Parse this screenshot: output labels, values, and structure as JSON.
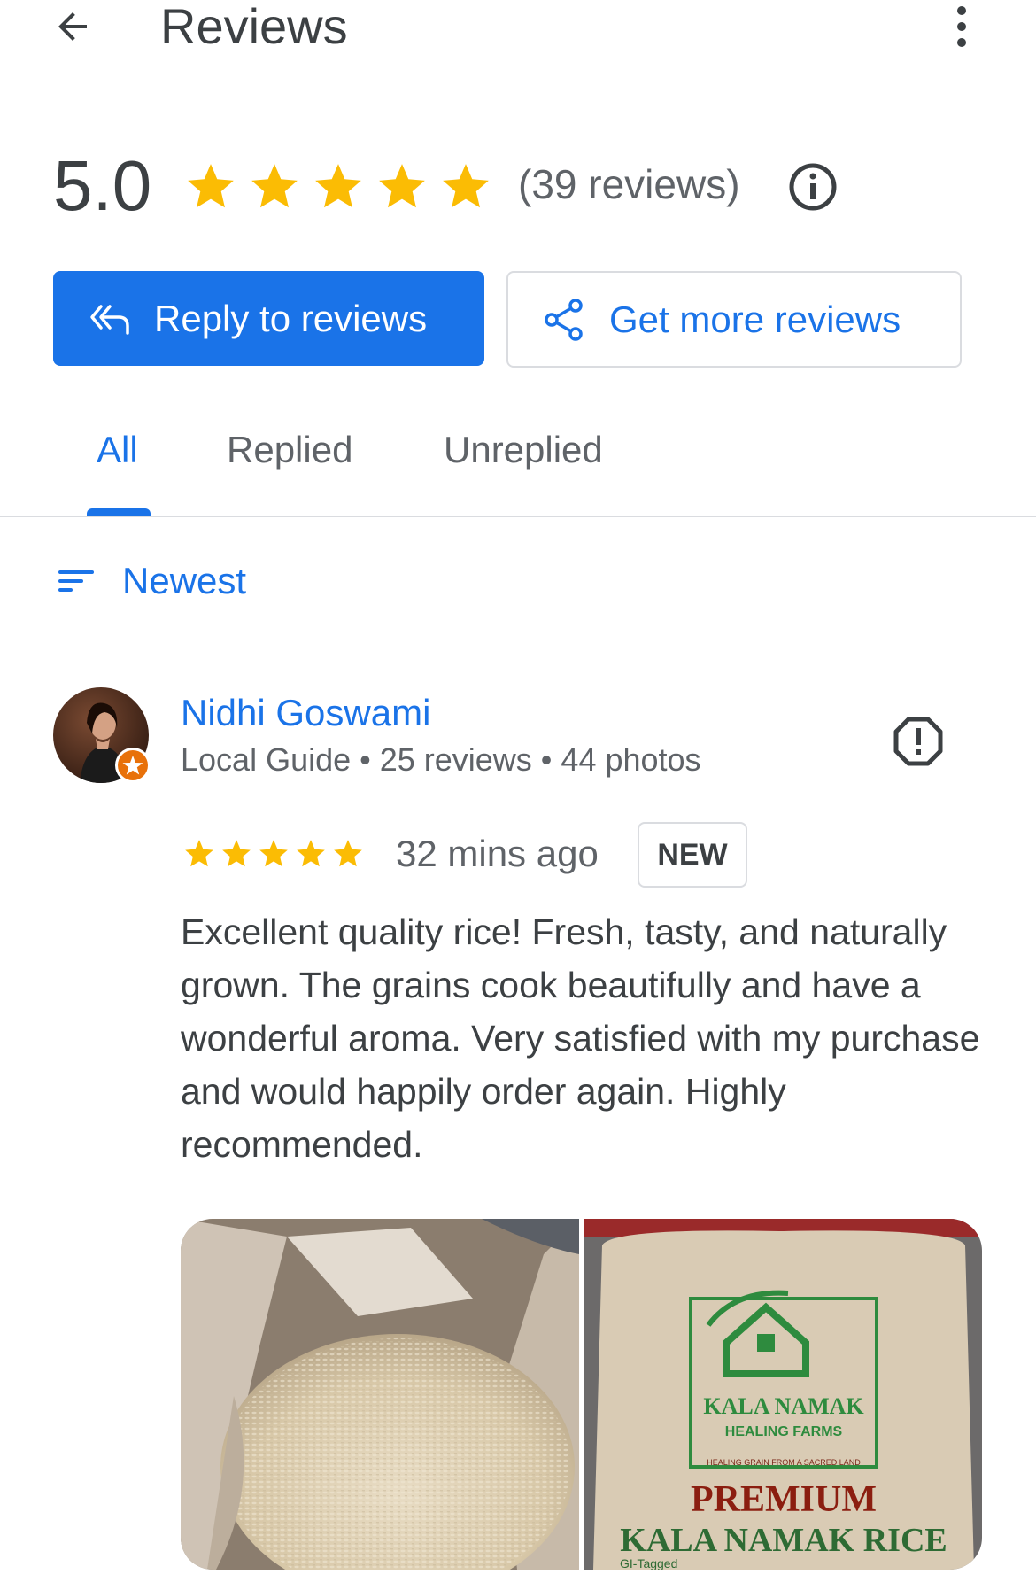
{
  "header": {
    "title": "Reviews"
  },
  "summary": {
    "rating": "5.0",
    "stars": 5,
    "count_text": "(39 reviews)"
  },
  "actions": {
    "reply_label": "Reply to reviews",
    "get_more_label": "Get more reviews"
  },
  "tabs": [
    {
      "label": "All",
      "active": true
    },
    {
      "label": "Replied",
      "active": false
    },
    {
      "label": "Unreplied",
      "active": false
    }
  ],
  "sort": {
    "label": "Newest"
  },
  "review": {
    "name": "Nidhi Goswami",
    "meta": "Local Guide • 25 reviews • 44 photos",
    "stars": 5,
    "time": "32 mins ago",
    "badge": "NEW",
    "text": "Excellent quality rice! Fresh, tasty, and naturally grown. The grains cook beautifully and have a wonderful aroma. Very satisfied with my purchase and would happily order again. Highly recommended.",
    "photo2_text": {
      "brand1": "KALA NAMAK",
      "brand2": "HEALING FARMS",
      "tagline": "HEALING GRAIN FROM A SACRED LAND",
      "line1": "PREMIUM",
      "line2": "KALA NAMAK RICE",
      "line3": "GI-Tagged"
    }
  },
  "colors": {
    "accent": "#1a73e8",
    "star": "#fbbc04",
    "text": "#3c4043",
    "muted": "#5f6368"
  }
}
